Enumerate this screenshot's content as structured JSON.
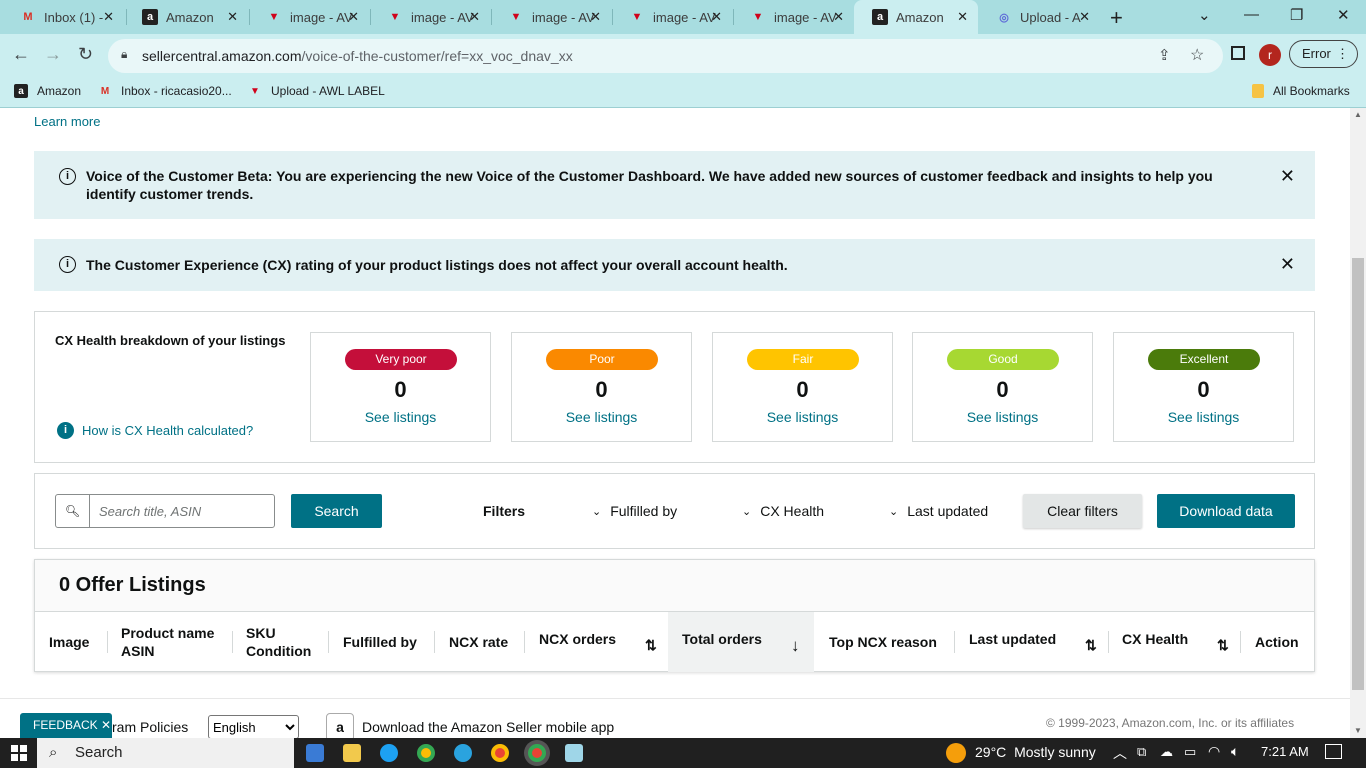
{
  "browser": {
    "tabs": [
      {
        "title": "Inbox (1) -",
        "icon": "gmail-icon",
        "active": false
      },
      {
        "title": "Amazon",
        "icon": "amazon-icon",
        "active": false
      },
      {
        "title": "image - AV",
        "icon": "awl-icon",
        "active": false
      },
      {
        "title": "image - AV",
        "icon": "awl-icon",
        "active": false
      },
      {
        "title": "image - AV",
        "icon": "awl-icon",
        "active": false
      },
      {
        "title": "image - AV",
        "icon": "awl-icon",
        "active": false
      },
      {
        "title": "image - AV",
        "icon": "awl-icon",
        "active": false
      },
      {
        "title": "Amazon",
        "icon": "amazon-icon",
        "active": true
      },
      {
        "title": "Upload - A",
        "icon": "upload-icon",
        "active": false
      }
    ],
    "url_host": "sellercentral.amazon.com",
    "url_path": "/voice-of-the-customer/ref=xx_voc_dnav_xx",
    "profile_initial": "r",
    "error_label": "Error",
    "bookmarks": [
      {
        "label": "Amazon",
        "icon": "amazon-icon"
      },
      {
        "label": "Inbox - ricacasio20...",
        "icon": "gmail-icon"
      },
      {
        "label": "Upload - AWL LABEL",
        "icon": "awl-icon"
      }
    ],
    "all_bookmarks": "All Bookmarks"
  },
  "page": {
    "learn_more": "Learn more",
    "alert_beta": "Voice of the Customer Beta: You are experiencing the new Voice of the Customer Dashboard. We have added new sources of customer feedback and insights to help you identify customer trends.",
    "alert_cx": "The Customer Experience (CX) rating of your product listings does not affect your overall account health.",
    "cx": {
      "title": "CX Health breakdown of your listings",
      "help_link": "How is CX Health calculated?",
      "see_label": "See listings",
      "ratings": [
        {
          "label": "Very poor",
          "count": "0",
          "color": "#c40f3a",
          "text_color": "#ffffff"
        },
        {
          "label": "Poor",
          "count": "0",
          "color": "#fa8900",
          "text_color": "#ffffff"
        },
        {
          "label": "Fair",
          "count": "0",
          "color": "#ffc400",
          "text_color": "#ffffff"
        },
        {
          "label": "Good",
          "count": "0",
          "color": "#a7d832",
          "text_color": "#ffffff"
        },
        {
          "label": "Excellent",
          "count": "0",
          "color": "#4b7b0b",
          "text_color": "#ffffff"
        }
      ]
    },
    "filters": {
      "search_placeholder": "Search title, ASIN",
      "search_button": "Search",
      "filters_label": "Filters",
      "fulfilled_by": "Fulfilled by",
      "cx_health": "CX Health",
      "last_updated": "Last updated",
      "clear_button": "Clear filters",
      "download_button": "Download data"
    },
    "listings": {
      "title": "0 Offer Listings",
      "columns": {
        "image": "Image",
        "product_name": "Product name",
        "asin": "ASIN",
        "sku": "SKU",
        "condition": "Condition",
        "fulfilled_by": "Fulfilled by",
        "ncx_rate": "NCX rate",
        "ncx_orders": "NCX orders",
        "total_orders": "Total orders",
        "top_ncx_reason": "Top NCX reason",
        "last_updated": "Last updated",
        "cx_health": "CX Health",
        "action": "Action"
      }
    },
    "footer": {
      "feedback": "FEEDBACK",
      "program_policies": "ram Policies",
      "language": "English",
      "app_download": "Download the Amazon Seller mobile app",
      "copyright": "© 1999-2023, Amazon.com, Inc. or its affiliates"
    }
  },
  "taskbar": {
    "search": "Search",
    "temperature": "29°C",
    "weather": "Mostly sunny",
    "time": "7:21 AM"
  }
}
